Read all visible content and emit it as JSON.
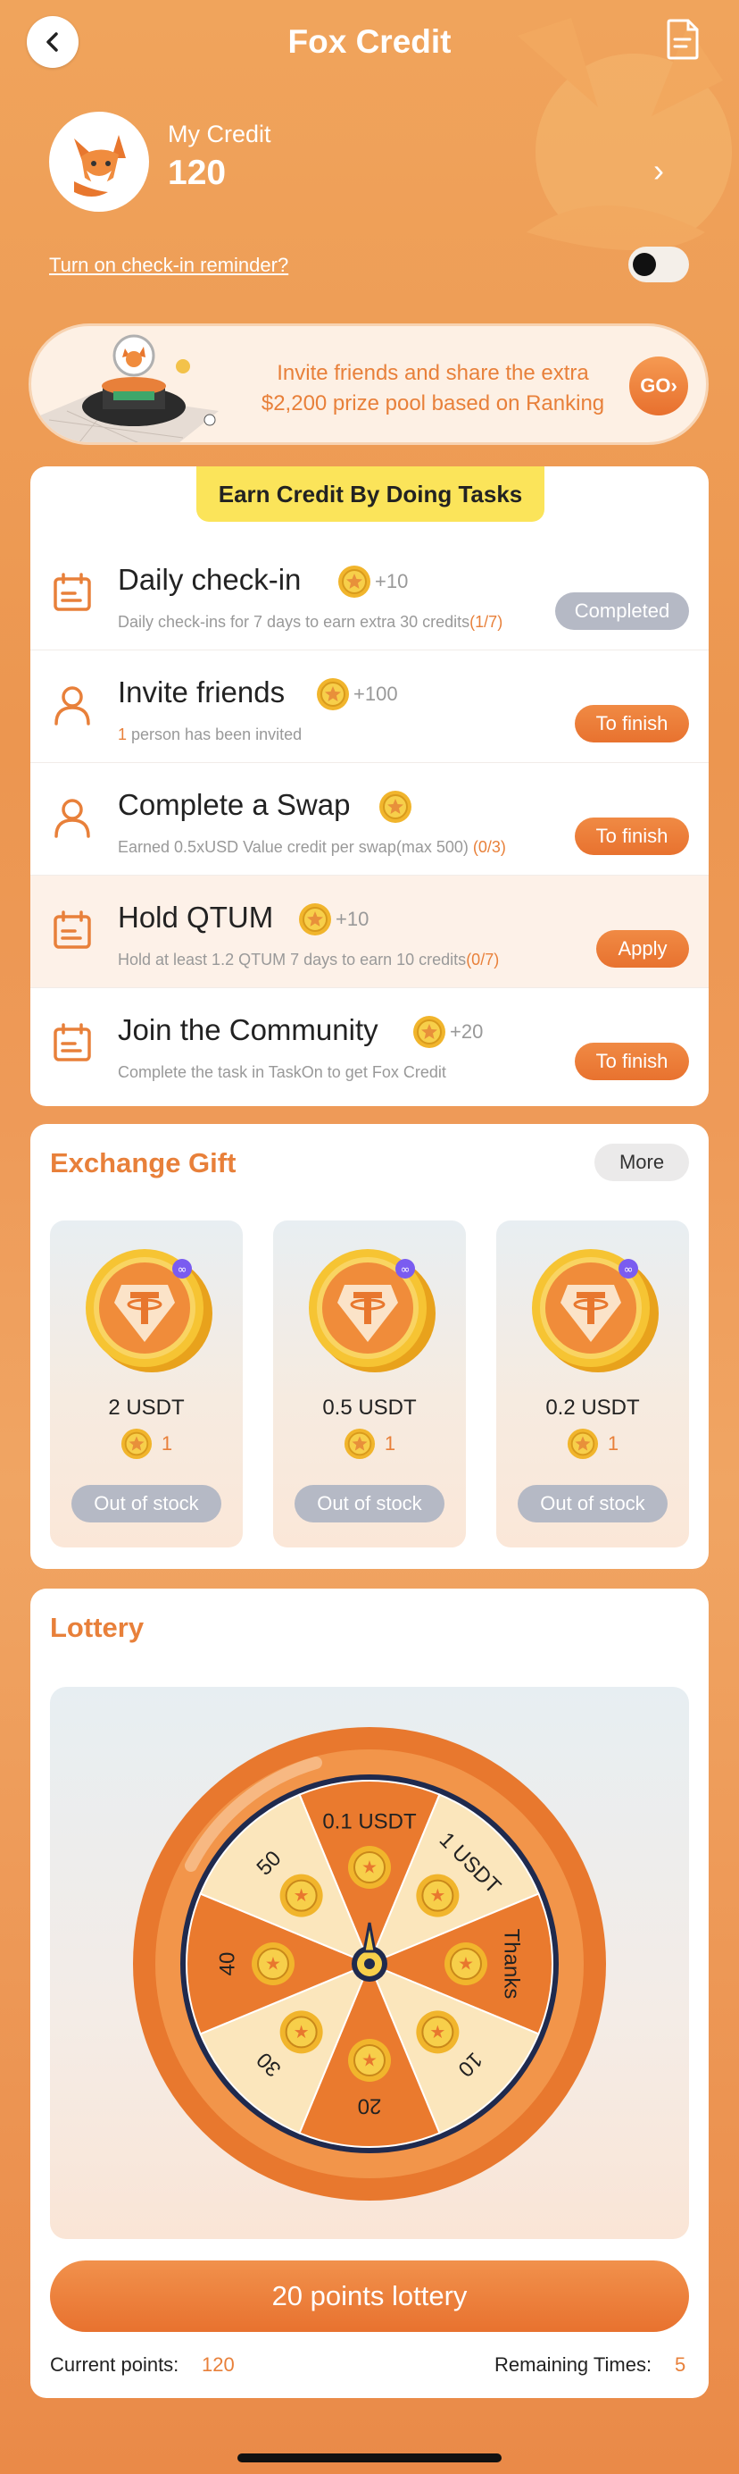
{
  "header": {
    "title": "Fox Credit",
    "back_icon": "chevron-left-icon",
    "doc_icon": "document-icon"
  },
  "credit": {
    "label": "My Credit",
    "value": "120",
    "chevron": "›"
  },
  "reminder": {
    "link_text": "Turn on check-in reminder?",
    "toggle_on": false
  },
  "banner": {
    "line1": "Invite friends and share the extra",
    "line2": "$2,200 prize pool based on Ranking",
    "go_label": "GO›"
  },
  "tasks": {
    "tab_title": "Earn Credit By Doing Tasks",
    "items": [
      {
        "title": "Daily check-in",
        "reward": "+10",
        "desc": "Daily check-ins for 7 days to earn extra 30 credits",
        "progress": "(1/7)",
        "button": "Completed",
        "icon": "calendar-icon"
      },
      {
        "title": "Invite friends",
        "reward": "+100",
        "desc_hl": "1",
        "desc": " person has been invited",
        "button": "To finish",
        "icon": "person-icon"
      },
      {
        "title": "Complete a Swap",
        "reward": "",
        "desc": "Earned 0.5xUSD Value credit per swap(max 500)",
        "progress": "(0/3)",
        "button": "To finish",
        "icon": "person-icon"
      },
      {
        "title": "Hold QTUM",
        "reward": "+10",
        "desc": "Hold at least 1.2 QTUM 7 days to earn 10 credits",
        "progress": "(0/7)",
        "button": "Apply",
        "icon": "calendar-icon"
      },
      {
        "title": "Join the Community",
        "reward": "+20",
        "desc": "Complete the task in TaskOn to get Fox Credit",
        "button": "To finish",
        "icon": "calendar-icon"
      }
    ]
  },
  "exchange": {
    "title": "Exchange Gift",
    "more_label": "More",
    "items": [
      {
        "name": "2 USDT",
        "cost": "1",
        "button": "Out of stock"
      },
      {
        "name": "0.5 USDT",
        "cost": "1",
        "button": "Out of stock"
      },
      {
        "name": "0.2 USDT",
        "cost": "1",
        "button": "Out of stock"
      }
    ]
  },
  "lottery": {
    "title": "Lottery",
    "segments": [
      "0.1 USDT",
      "1 USDT",
      "Thanks",
      "10",
      "20",
      "30",
      "40",
      "50"
    ],
    "button_label": "20 points lottery",
    "current_points_label": "Current points:",
    "current_points": "120",
    "remaining_label": "Remaining Times:",
    "remaining": "5"
  },
  "colors": {
    "accent": "#e8803a",
    "bg_orange": "#ec9650",
    "yellow_tab": "#fbe45a",
    "gray_button": "#b5b9c5"
  }
}
